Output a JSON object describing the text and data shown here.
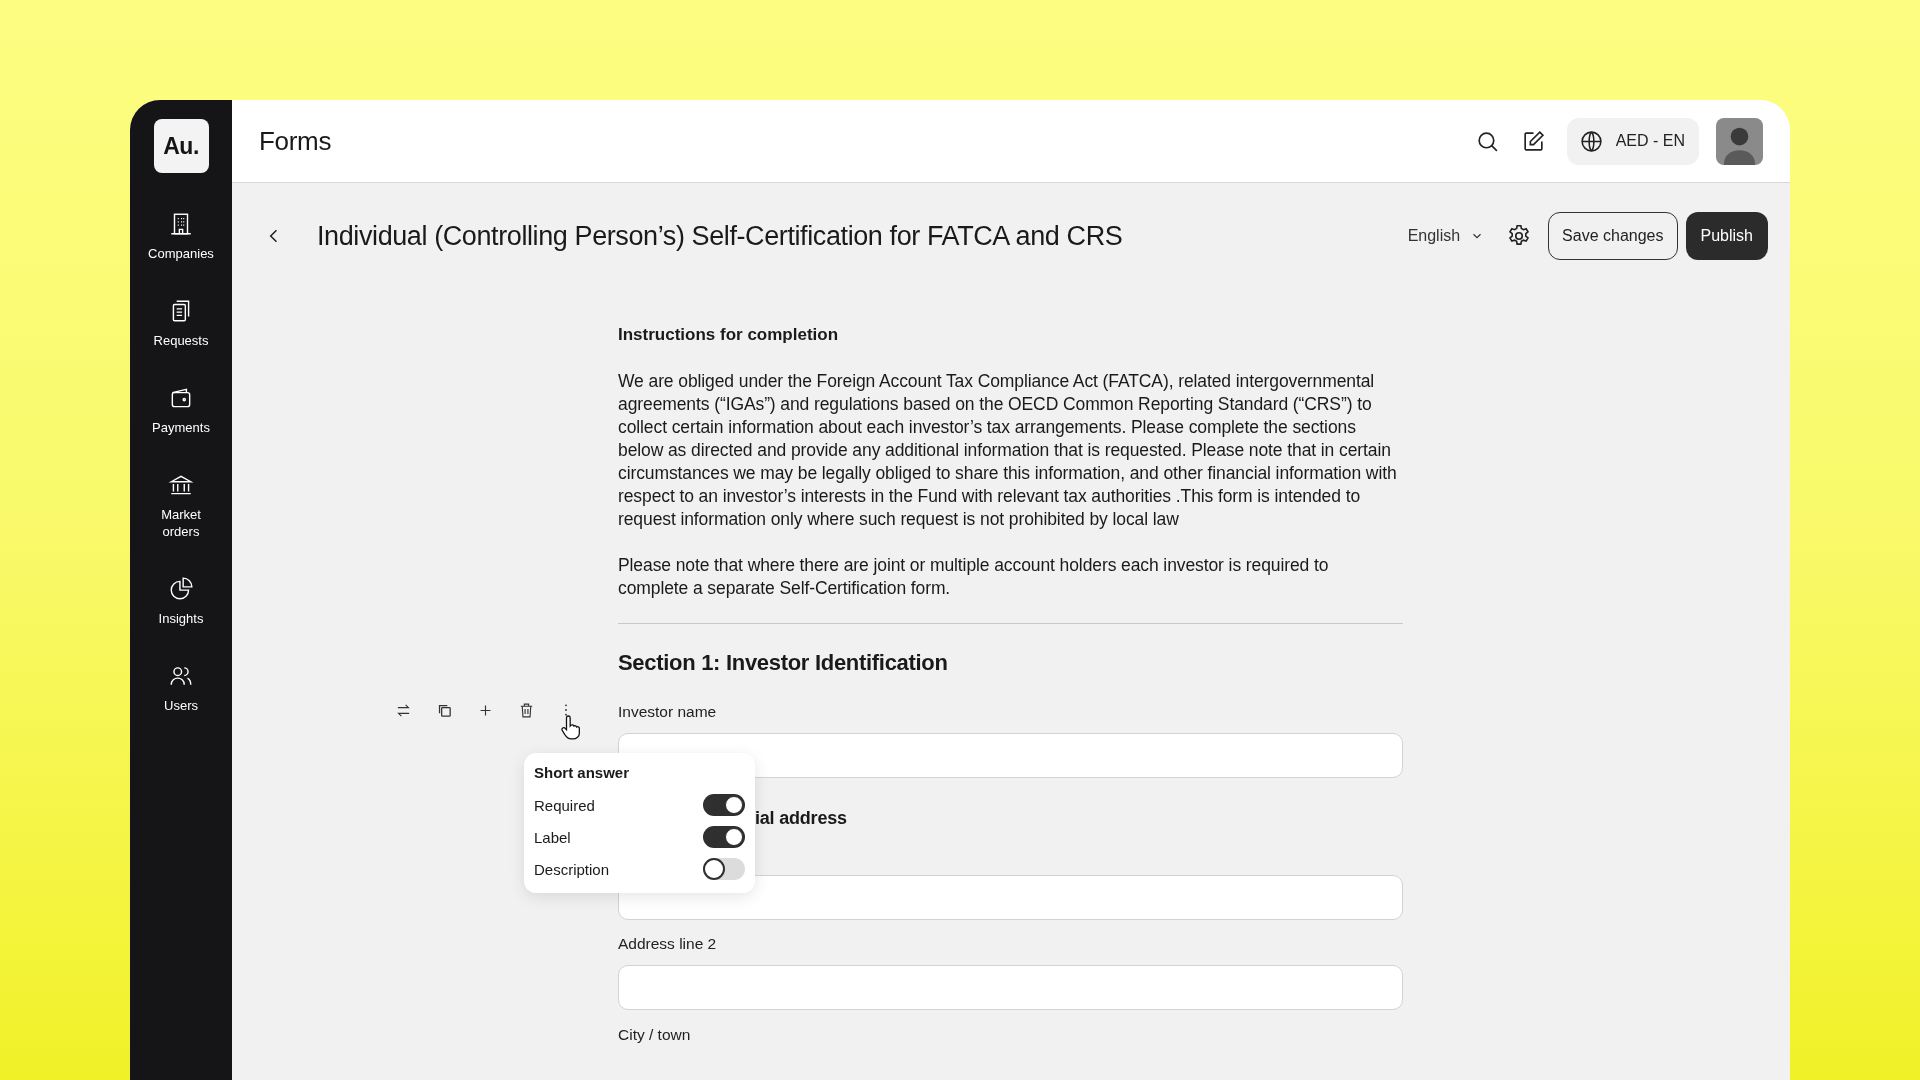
{
  "brand": {
    "logo": "Au."
  },
  "nav": [
    {
      "label": "Companies"
    },
    {
      "label": "Requests"
    },
    {
      "label": "Payments"
    },
    {
      "label": "Market orders"
    },
    {
      "label": "Insights"
    },
    {
      "label": "Users"
    }
  ],
  "header": {
    "title": "Forms",
    "locale": "AED - EN"
  },
  "page": {
    "title": "Individual (Controlling Person’s) Self-Certification for FATCA and CRS",
    "language": "English",
    "buttons": [
      {
        "label": "Save changes",
        "kind": "outline"
      },
      {
        "label": "Publish",
        "kind": "primary"
      }
    ]
  },
  "instructions": {
    "title": "Instructions for completion",
    "paragraphs": [
      "We are obliged under the Foreign Account Tax Compliance Act (FATCA), related intergovernmental agreements (“IGAs”) and regulations based on the OECD Common Reporting Standard (“CRS”) to collect certain information about each investor’s tax arrangements. Please complete the sections below as directed and provide any additional information that is requested. Please note that in certain circumstances we may be legally obliged to share this information, and other financial information with respect to an investor’s interests in the Fund with relevant tax authorities .This form is intended to request information only where such request is not prohibited by local law",
      "Please note that where there are joint or multiple account holders each investor is required to complete a separate Self-Certification form."
    ]
  },
  "section": {
    "title": "Section 1: Investor Identification",
    "items": [
      {
        "kind": "field",
        "label": "Investor name"
      },
      {
        "kind": "subheading",
        "text": "ial address"
      },
      {
        "kind": "field"
      },
      {
        "kind": "field",
        "label": "Address line 2"
      },
      {
        "kind": "label",
        "label": "City / town"
      }
    ]
  },
  "field_menu": {
    "title": "Short answer",
    "options": [
      {
        "label": "Required",
        "on": true
      },
      {
        "label": "Label",
        "on": true
      },
      {
        "label": "Description",
        "on": false
      }
    ]
  }
}
